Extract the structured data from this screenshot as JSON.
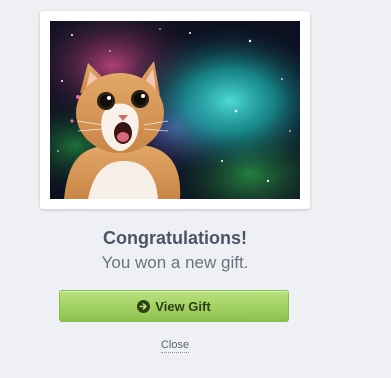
{
  "gift_modal": {
    "image_alt": "Surprised cat in space",
    "title": "Congratulations!",
    "subtitle": "You won a new gift.",
    "view_button_label": "View Gift",
    "view_button_icon": "circle-arrow-right-icon",
    "close_label": "Close"
  },
  "colors": {
    "page_background": "#eff0f4",
    "button_green_top": "#b9e27f",
    "button_green_bottom": "#8fc24e",
    "title_color": "#4b5566"
  }
}
